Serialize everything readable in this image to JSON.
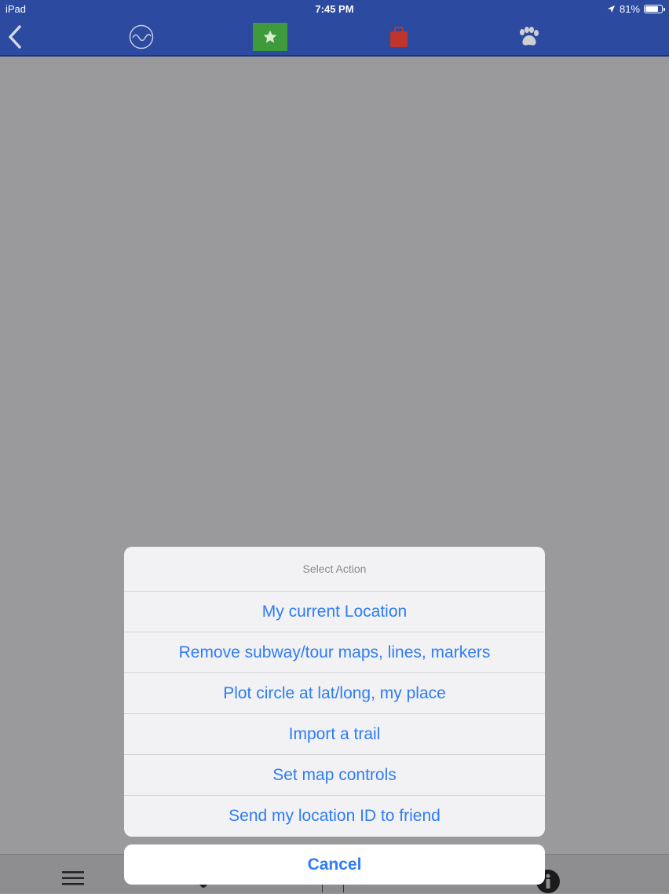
{
  "statusbar": {
    "device": "iPad",
    "time": "7:45 PM",
    "battery_text": "81%",
    "battery_level": 0.81,
    "icons": [
      "location-arrow-icon",
      "battery-icon"
    ]
  },
  "navbar": {
    "icons": [
      "back-chevron-icon",
      "wave-circle-icon",
      "star-icon",
      "bag-icon",
      "paw-icon"
    ],
    "colors": {
      "bar": "#2b4aa0",
      "star_box": "#3e9a3a",
      "bag": "#c0352b",
      "paw": "#cfcfd4"
    }
  },
  "action_sheet": {
    "title": "Select Action",
    "actions": [
      "My current Location",
      "Remove subway/tour maps, lines, markers",
      "Plot circle at lat/long, my place",
      "Import a trail",
      "Set map controls",
      "Send my location ID to friend"
    ],
    "cancel": "Cancel",
    "accent": "#2e7cf6"
  },
  "toolbar": {
    "icons": [
      "menu-icon",
      "info-icon"
    ]
  }
}
